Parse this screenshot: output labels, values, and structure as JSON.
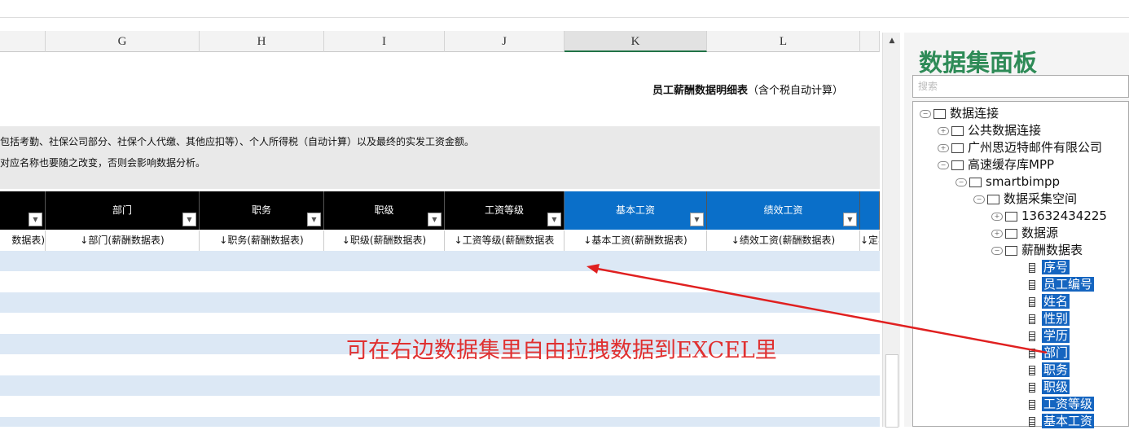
{
  "columns": [
    "G",
    "H",
    "I",
    "J",
    "K",
    "L"
  ],
  "sheet": {
    "title_bold": "员工薪酬数据明细表",
    "title_note": "（含个税自动计算）",
    "note_line1": "包括考勤、社保公司部分、社保个人代缴、其他应扣等）、个人所得税（自动计算）以及最终的实发工资金额。",
    "note_line2": "对应名称也要随之改变，否则会影响数据分析。",
    "headers": [
      "部门",
      "职务",
      "职级",
      "工资等级",
      "基本工资",
      "绩效工资"
    ],
    "fields": [
      "数据表)",
      "↓部门(薪酬数据表)",
      "↓职务(薪酬数据表)",
      "↓职级(薪酬数据表)",
      "↓工资等级(薪酬数据表",
      "↓基本工资(薪酬数据表)",
      "↓绩效工资(薪酬数据表)",
      "↓定非"
    ]
  },
  "annotation": "可在右边数据集里自由拉拽数据到EXCEL里",
  "colors": {
    "accent_blue": "#0a6fc9",
    "header_black": "#000000",
    "stripe": "#dce8f5",
    "annotation_red": "#e03030",
    "panel_title": "#2e8b57"
  },
  "panel": {
    "title": "数据集面板",
    "search_placeholder": "搜索",
    "tree": [
      "数据连接",
      "公共数据连接",
      "广州思迈特邮件有限公司",
      "高速缓存库MPP",
      "smartbimpp",
      "数据采集空间",
      "13632434225",
      "数据源",
      "薪酬数据表"
    ],
    "fields": [
      "序号",
      "员工编号",
      "姓名",
      "性别",
      "学历",
      "部门",
      "职务",
      "职级",
      "工资等级",
      "基本工资"
    ]
  }
}
